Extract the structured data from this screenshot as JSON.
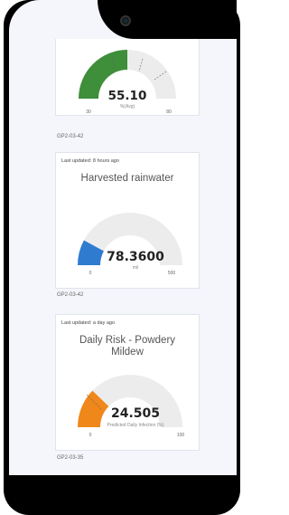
{
  "gauges": [
    {
      "updated": "",
      "title": "",
      "value": "55.10",
      "unit": "%(Avg)",
      "min": "30",
      "max": "80",
      "fill_fraction": 0.5,
      "color": "#3e8e3a",
      "device": "GP2-03-42"
    },
    {
      "updated": "Last updated: 8 hours ago",
      "title": "Harvested rainwater",
      "value": "78.3600",
      "unit": "mil",
      "min": "0",
      "max": "500",
      "fill_fraction": 0.157,
      "color": "#2f7bd0",
      "device": "GP2-03-42"
    },
    {
      "updated": "Last updated: a day ago",
      "title_line1": "Daily Risk - Powdery",
      "title_line2": "Mildew",
      "value": "24.505",
      "unit": "Predicted Daily Infection (%)",
      "min": "0",
      "max": "100",
      "fill_fraction": 0.245,
      "color": "#f0871a",
      "device": "GP2-03-35"
    }
  ]
}
